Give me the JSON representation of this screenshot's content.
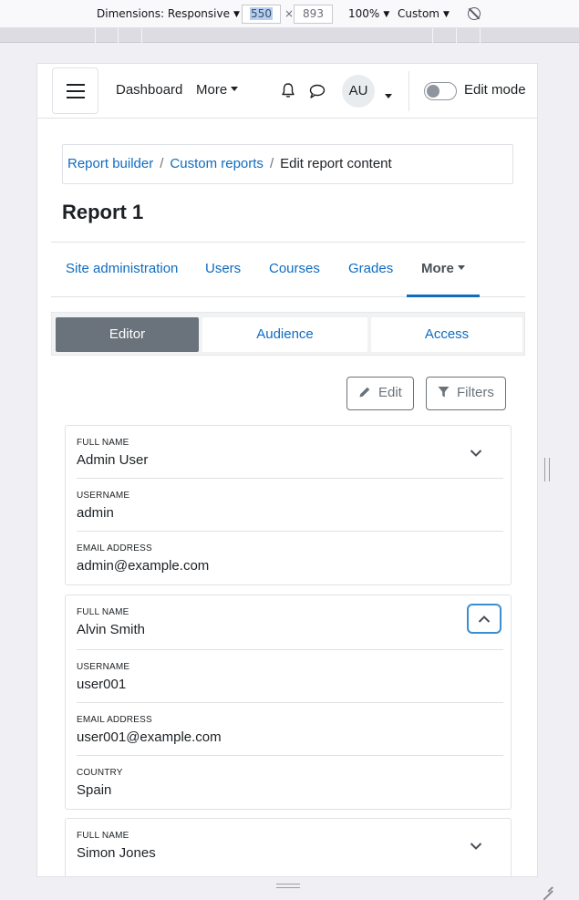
{
  "devtools": {
    "dimensions_label": "Dimensions: Responsive",
    "width": "550",
    "x": "×",
    "height": "893",
    "zoom": "100%",
    "throttle": "Custom"
  },
  "navbar": {
    "dashboard": "Dashboard",
    "more": "More",
    "avatar_initials": "AU",
    "edit_mode_label": "Edit mode",
    "edit_mode_on": false
  },
  "breadcrumb": {
    "items": [
      "Report builder",
      "Custom reports"
    ],
    "separator": "/",
    "current": "Edit report content"
  },
  "page_title": "Report 1",
  "secondary_nav": {
    "tabs": [
      "Site administration",
      "Users",
      "Courses",
      "Grades"
    ],
    "more": "More"
  },
  "editor_tabs": [
    "Editor",
    "Audience",
    "Access"
  ],
  "actions": {
    "edit": "Edit",
    "filters": "Filters"
  },
  "cards": [
    {
      "fields": [
        {
          "label": "FULL NAME",
          "value": "Admin User"
        },
        {
          "label": "USERNAME",
          "value": "admin"
        },
        {
          "label": "EMAIL ADDRESS",
          "value": "admin@example.com"
        }
      ],
      "expanded": false
    },
    {
      "fields": [
        {
          "label": "FULL NAME",
          "value": "Alvin Smith"
        },
        {
          "label": "USERNAME",
          "value": "user001"
        },
        {
          "label": "EMAIL ADDRESS",
          "value": "user001@example.com"
        },
        {
          "label": "COUNTRY",
          "value": "Spain"
        }
      ],
      "expanded": true
    },
    {
      "fields": [
        {
          "label": "FULL NAME",
          "value": "Simon Jones"
        }
      ],
      "expanded": false
    }
  ],
  "colors": {
    "link": "#0f6cbf",
    "active_tab_bg": "#6a737b",
    "focus_ring": "#3a8fd0"
  }
}
